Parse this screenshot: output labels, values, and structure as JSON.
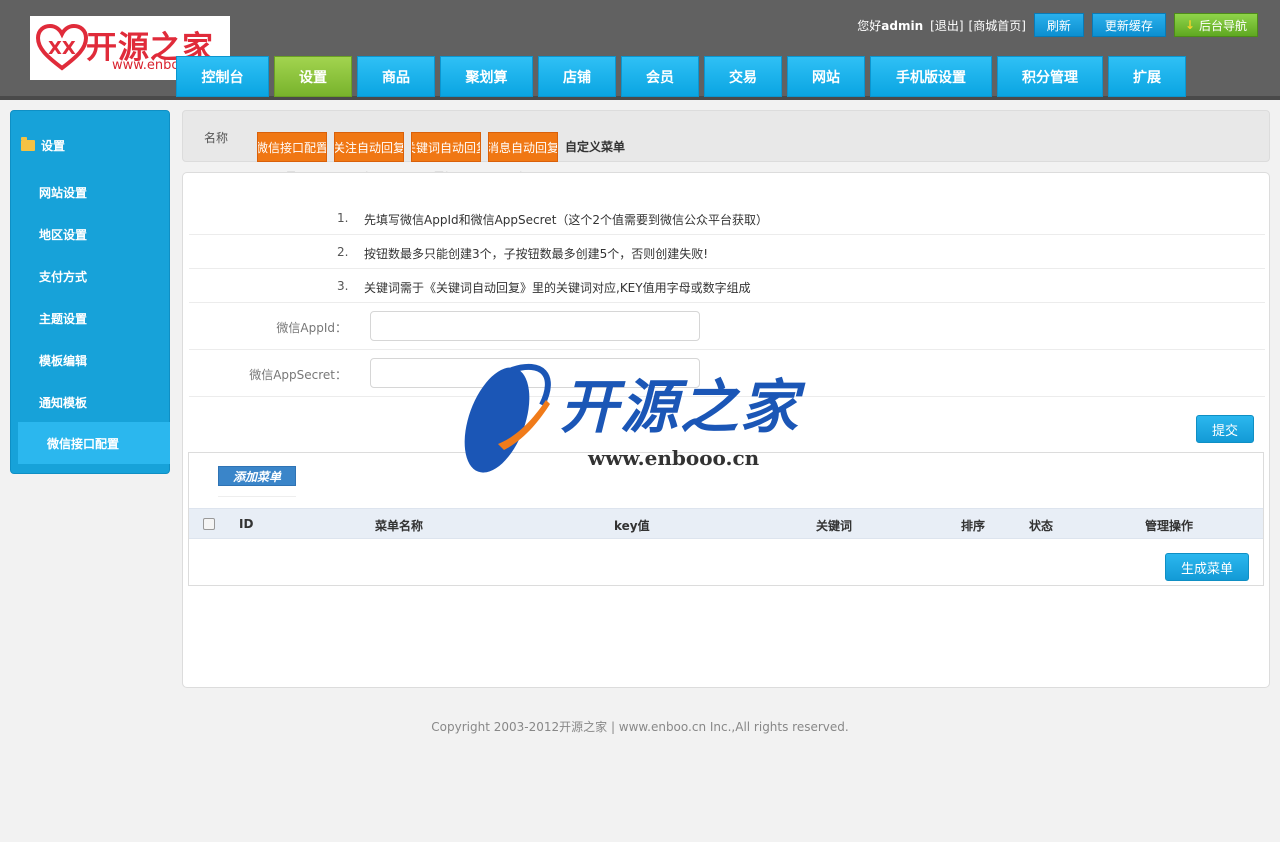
{
  "header": {
    "logo_text": "开源之家",
    "logo_url": "www.enbo",
    "greeting_prefix": "您好",
    "username": "admin",
    "logout_link": "[退出]",
    "mall_link": "[商城首页]",
    "refresh_button": "刷新",
    "update_cache_button": "更新缓存",
    "backend_nav_button": "后台导航"
  },
  "nav": [
    {
      "label": "控制台",
      "active": false
    },
    {
      "label": "设置",
      "active": true
    },
    {
      "label": "商品",
      "active": false
    },
    {
      "label": "聚划算",
      "active": false
    },
    {
      "label": "店铺",
      "active": false
    },
    {
      "label": "会员",
      "active": false
    },
    {
      "label": "交易",
      "active": false
    },
    {
      "label": "网站",
      "active": false
    },
    {
      "label": "手机版设置",
      "active": false
    },
    {
      "label": "积分管理",
      "active": false
    },
    {
      "label": "扩展",
      "active": false
    }
  ],
  "sidebar": {
    "heading": "设置",
    "items": [
      "网站设置",
      "地区设置",
      "支付方式",
      "主题设置",
      "模板编辑",
      "通知模板"
    ],
    "active_item": "微信接口配置"
  },
  "tabs": {
    "name_label": "名称",
    "items": [
      "微信接口配置",
      "关注自动回复",
      "关键词自动回复",
      "消息自动回复"
    ],
    "overflow": [
      "置",
      "复",
      "回复",
      "复"
    ],
    "plain_tab": "自定义菜单"
  },
  "tips": [
    {
      "num": "1.",
      "text": "先填写微信AppId和微信AppSecret（这个2个值需要到微信公众平台获取）"
    },
    {
      "num": "2.",
      "text": "按钮数最多只能创建3个，子按钮数最多创建5个，否则创建失败!"
    },
    {
      "num": "3.",
      "text": "关键词需于《关键词自动回复》里的关键词对应,KEY值用字母或数字组成"
    }
  ],
  "form": {
    "appid_label": "微信AppId：",
    "appid_value": "",
    "secret_label": "微信AppSecret：",
    "secret_value": "",
    "submit_button": "提交"
  },
  "menu_table": {
    "add_button": "添加菜单",
    "columns": [
      "ID",
      "菜单名称",
      "key值",
      "关键词",
      "排序",
      "状态",
      "管理操作"
    ],
    "generate_button": "生成菜单"
  },
  "watermark": {
    "text": "开源之家",
    "url": "www.enbooo.cn"
  },
  "footer": {
    "copyright": "Copyright 2003-2012开源之家 | www.enboo.cn Inc.,All rights reserved."
  },
  "colors": {
    "header_bg": "#616161",
    "nav_blue": "#0aa5e2",
    "nav_active_green": "#78b32c",
    "sidebar_blue": "#17a2d9",
    "tab_orange": "#f07713",
    "button_blue": "#139ad6"
  }
}
